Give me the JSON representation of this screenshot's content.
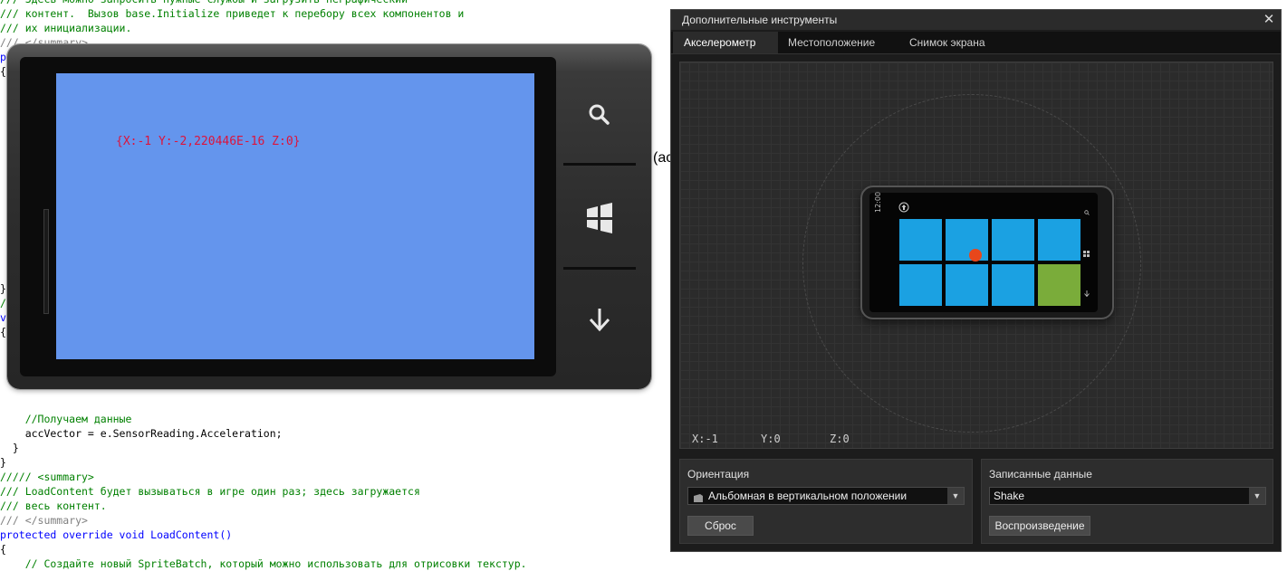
{
  "code_editor": {
    "lines": [
      {
        "text": "/// Здесь можно запросить нужные службы и загрузить неграфический",
        "cls": "c-comment"
      },
      {
        "text": "/// контент.  Вызов base.Initialize приведет к перебору всех компонентов и",
        "cls": "c-comment"
      },
      {
        "text": "/// их инициализации.",
        "cls": "c-comment"
      },
      {
        "text": "/// </summary>",
        "cls": "c-gray"
      },
      {
        "text": "protected override void Initialize()",
        "cls": "c-kw"
      },
      {
        "text": "{",
        "cls": ""
      },
      {
        "text": "",
        "cls": ""
      },
      {
        "text": "",
        "cls": ""
      },
      {
        "text": "",
        "cls": ""
      },
      {
        "text": "",
        "cls": ""
      },
      {
        "text": "",
        "cls": ""
      },
      {
        "text": "",
        "cls": ""
      },
      {
        "text": "",
        "cls": ""
      },
      {
        "text": "",
        "cls": ""
      },
      {
        "text": "",
        "cls": ""
      },
      {
        "text": "",
        "cls": ""
      },
      {
        "text": "",
        "cls": ""
      },
      {
        "text": "",
        "cls": ""
      },
      {
        "text": "",
        "cls": ""
      },
      {
        "text": "",
        "cls": ""
      },
      {
        "text": "}",
        "cls": ""
      },
      {
        "text": "//",
        "cls": "c-comment"
      },
      {
        "text": "void",
        "cls": "c-kw"
      },
      {
        "text": "{",
        "cls": ""
      },
      {
        "text": "",
        "cls": ""
      },
      {
        "text": "",
        "cls": ""
      },
      {
        "text": "",
        "cls": ""
      },
      {
        "text": "",
        "cls": ""
      },
      {
        "text": "",
        "cls": ""
      },
      {
        "text": "    //Получаем данные",
        "cls": "c-comment"
      },
      {
        "text": "    accVector = e.SensorReading.Acceleration;",
        "cls": ""
      },
      {
        "text": "  }",
        "cls": ""
      },
      {
        "text": "}",
        "cls": ""
      },
      {
        "text": "///// <summary>",
        "cls": "c-comment"
      },
      {
        "text": "/// LoadContent будет вызываться в игре один раз; здесь загружается",
        "cls": "c-comment"
      },
      {
        "text": "/// весь контент.",
        "cls": "c-comment"
      },
      {
        "text": "/// </summary>",
        "cls": "c-gray"
      },
      {
        "text": "protected override void LoadContent()",
        "cls": "c-kw"
      },
      {
        "text": "{",
        "cls": ""
      },
      {
        "text": "    // Создайте новый SpriteBatch, который можно использовать для отрисовки текстур.",
        "cls": "c-comment"
      }
    ],
    "fragment": "(ac"
  },
  "phone_screen": {
    "readout": "{X:-1 Y:-2,220446E-16 Z:0}"
  },
  "tools_window": {
    "title": "Дополнительные инструменты",
    "close_glyph": "✕",
    "tabs": [
      "Акселерометр",
      "Местоположение",
      "Снимок экрана"
    ],
    "active_tab": "Акселерометр",
    "readouts": {
      "x": "X:-1",
      "y": "Y:0",
      "z": "Z:0"
    },
    "mini_phone": {
      "clock": "12:00"
    },
    "tile_colors": {
      "blue": "#1ba1e2",
      "green": "#7aac3a"
    },
    "orientation": {
      "label": "Ориентация",
      "selected": "Альбомная в вертикальном положении",
      "reset_button": "Сброс"
    },
    "recorded": {
      "label": "Записанные данные",
      "selected": "Shake",
      "play_button": "Воспроизведение"
    }
  },
  "colors": {
    "screen_bg": "#6495ed",
    "readout_text": "#dc143c",
    "accel_dot": "#e8471b"
  }
}
